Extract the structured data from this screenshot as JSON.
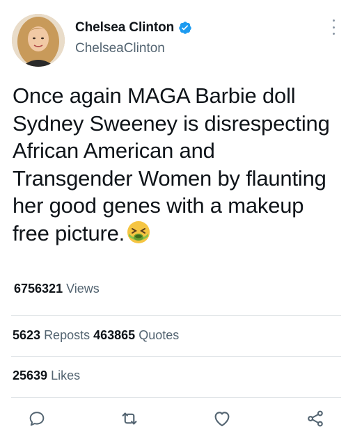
{
  "tweet": {
    "author": {
      "display_name": "Chelsea Clinton",
      "handle": "ChelseaClinton",
      "verified": true
    },
    "text": "Once again MAGA Barbie doll Sydney Sweeney is disrespecting African American and Transgender Women by flaunting her good genes with a makeup free picture.",
    "emoji": "nauseated-face",
    "views": {
      "count": "6756321",
      "label": "Views"
    },
    "reposts": {
      "count": "5623",
      "label": "Reposts"
    },
    "quotes": {
      "count": "463865",
      "label": "Quotes"
    },
    "likes": {
      "count": "25639",
      "label": "Likes"
    }
  },
  "actions": [
    "reply",
    "repost",
    "like",
    "share"
  ],
  "colors": {
    "text": "#0f1419",
    "secondary": "#536471",
    "verified_blue": "#1d9bf0",
    "divider": "#dfe3e6",
    "icon": "#536471"
  }
}
